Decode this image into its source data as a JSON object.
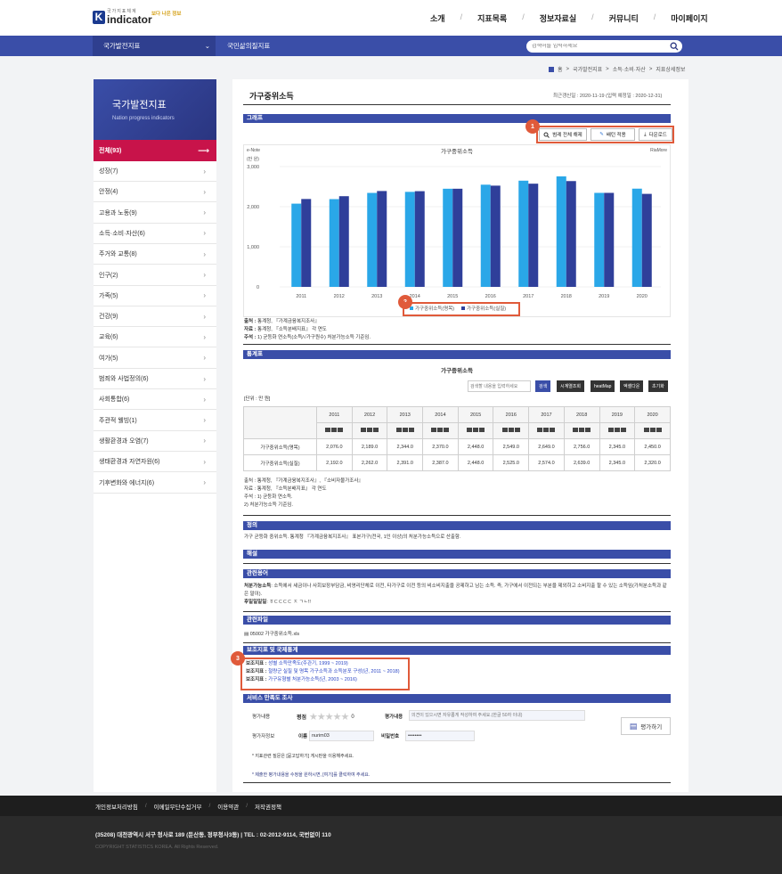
{
  "header": {
    "logo_small": "국가지표체계",
    "logo_main": "indicator",
    "logo_k": "K",
    "badge": "보다 나은 정보",
    "gnb": [
      "소개",
      "지표목록",
      "정보자료실",
      "커뮤니티",
      "마이페이지"
    ]
  },
  "navbar": {
    "primary": "국가발전지표",
    "secondary": "국민삶의질지표",
    "search_placeholder": "검색어를 입력하세요"
  },
  "breadcrumb": [
    "홈",
    "국가발전지표",
    "소득·소비·자산",
    "지표상세정보"
  ],
  "sidebar": {
    "title": "국가발전지표",
    "subtitle": "Nation progress indicators",
    "active": "전체(93)",
    "items": [
      "성장(7)",
      "안정(4)",
      "고용과 노동(9)",
      "소득·소비·자산(6)",
      "주거와 교통(8)",
      "인구(2)",
      "가족(5)",
      "건강(9)",
      "교육(6)",
      "여가(5)",
      "범죄와 사법정의(6)",
      "사회통합(6)",
      "주관적 웰빙(1)",
      "생활환경과 오염(7)",
      "생태환경과 자연자원(6)",
      "기후변화와 에너지(6)"
    ]
  },
  "page": {
    "title": "가구중위소득",
    "date": "최근갱신일 : 2020-11-19 (입력 예정일 : 2020-12-31)"
  },
  "graph_section": {
    "header": "그래프",
    "buttons": [
      "범례 전체 해제",
      "배턴 적용",
      "다운로드"
    ],
    "marker1": "1",
    "marker2": "2",
    "chart_title": "가구중위소득",
    "left_tag": "e-Note",
    "right_tag": "RiaMore",
    "unit": "(만 원)"
  },
  "chart_data": {
    "type": "bar",
    "title": "가구중위소득",
    "categories": [
      "2011",
      "2012",
      "2013",
      "2014",
      "2015",
      "2016",
      "2017",
      "2018",
      "2019",
      "2020"
    ],
    "series": [
      {
        "name": "가구중위소득(명목)",
        "color": "#2aa7e8",
        "values": [
          2076,
          2189,
          2344,
          2370,
          2448,
          2549,
          2649,
          2756,
          2345,
          2450
        ]
      },
      {
        "name": "가구중위소득(실질)",
        "color": "#2f3f9a",
        "values": [
          2192,
          2262,
          2391,
          2387,
          2448,
          2525,
          2574,
          2639,
          2345,
          2320
        ]
      }
    ],
    "yticks": [
      "0",
      "1,000",
      "2,000",
      "3,000"
    ],
    "ylim": [
      0,
      3000
    ],
    "ylabel": "(만 원)",
    "grid": true,
    "legend_position": "bottom"
  },
  "graph_notes": [
    {
      "label": "출처 :",
      "text": "통계청, 『가계금융복지조사』"
    },
    {
      "label": "자료 :",
      "text": "통계청, 『소득분배지표』 각 연도"
    },
    {
      "label": "주석 :",
      "text": "1) 균등화 연소득(소득/√가구원수) 처분가능소득 기준임."
    }
  ],
  "stat_section": {
    "header": "통계표",
    "table_title": "가구중위소득",
    "search_placeholder": "검색할 내용을 입력하세요",
    "buttons": [
      "검색",
      "시계열조회",
      "heatMap",
      "엑셀다운",
      "초기화"
    ],
    "unit": "[단위 : 만 원]",
    "years": [
      "2011",
      "2012",
      "2013",
      "2014",
      "2015",
      "2016",
      "2017",
      "2018",
      "2019",
      "2020"
    ],
    "rows": [
      {
        "name": "가구중위소득(명목)",
        "values": [
          "2,076.0",
          "2,189.0",
          "2,344.0",
          "2,370.0",
          "2,448.0",
          "2,549.0",
          "2,649.0",
          "2,756.0",
          "2,345.0",
          "2,450.0"
        ]
      },
      {
        "name": "가구중위소득(실질)",
        "values": [
          "2,192.0",
          "2,262.0",
          "2,391.0",
          "2,387.0",
          "2,448.0",
          "2,525.0",
          "2,574.0",
          "2,639.0",
          "2,345.0",
          "2,320.0"
        ]
      }
    ]
  },
  "table_notes": [
    "출처 : 통계청, 『가계금융복지조사』, 『소비자물가조사』",
    "자료 : 통계청, 『소득분배지표』 각 연도",
    "주석 : 1) 균등화 연소득.",
    "2) 처분가능소득 기준임."
  ],
  "definition": {
    "header": "정의",
    "text": "가구 균등화 중위소득. 통계청 『가계금융복지조사』 표본가구(전국, 1인 이상)의 처분가능소득으로 산출함."
  },
  "explanation": {
    "header": "해설"
  },
  "terms": {
    "header": "관련용어",
    "item1_label": "처분가능소득",
    "item1_text": ": 소득에서 세금이나 사회보장부담금, 비영리단체로 이전, 타가구로 이전 등의 비소비지출을 공제하고 남는 소득. 즉, 가구에서 이전되는 부분을 제외하고 소비지출 할 수 있는 소득임(가처분소득과 같은 말이).",
    "item2_label": "후일일일일",
    "item2_text": ": ㅎㄷㄷㄷㄷ ㅈ ㄱㄴ!!"
  },
  "files": {
    "header": "관련파일",
    "file": "05002 가구중위소득.xls"
  },
  "sub_indicators": {
    "header": "보조지표 및 국제통계",
    "marker": "3",
    "label": "보조지표 :",
    "items": [
      "성별 소득만족도(주관기, 1999 ~ 2019)",
      "철량군 실질 및 명목 가구소득과 소득분포 구성(년, 2011 ~ 2018)",
      "가구유형별 처분가능소득(년, 2003 ~ 2016)"
    ]
  },
  "survey": {
    "header": "서비스 만족도 조사",
    "rating_label": "평가내용",
    "score_label": "평점",
    "score_value": "0",
    "content_label": "평가내용",
    "content_placeholder": "의견이 있으시면 자유롭게 작성하여 주세요.(한글 50자 이내)",
    "info_label": "평가자정보",
    "name_label": "이름",
    "name_value": "nurim03",
    "pw_label": "비밀번호",
    "pw_value": "••••••••",
    "submit": "평가하기",
    "note1": "* 지표관련 질문은 [묻고답하기] 게시판을 이용해주세요.",
    "note2": "* 제출한 평가내용을 수정을 원하시면, [여기]를 클릭하여 주세요."
  },
  "footer": {
    "links": [
      "개인정보처리방침",
      "이메일무단수집거부",
      "이용약관",
      "저작권정책"
    ],
    "address": "(35208) 대전광역시 서구 청사로 189 (둔산동, 정부청사3동)  |  TEL : 02-2012-9114, 국번없이 110",
    "copyright": "COPYRIGHT STATISTICS KOREA. All Rights Reserved."
  }
}
